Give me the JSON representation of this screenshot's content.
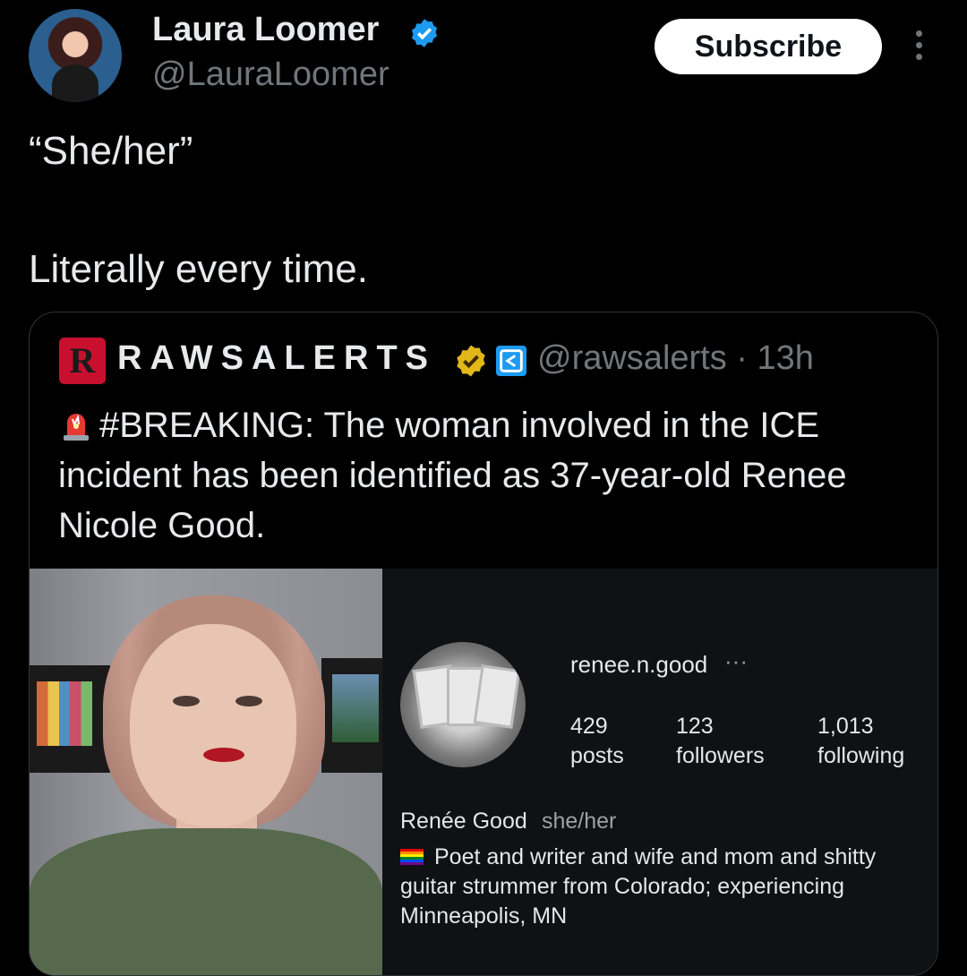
{
  "author": {
    "name": "Laura Loomer",
    "handle": "@LauraLoomer",
    "avatar_icon": "profile-photo",
    "verified_icon": "blue-verified-badge-icon"
  },
  "actions": {
    "subscribe_label": "Subscribe",
    "more_icon": "more-vertical-icon"
  },
  "tweet": {
    "line1": "“She/her”",
    "line2": "Literally every time."
  },
  "quoted": {
    "logo_letter": "R",
    "name": "RAWSALERTS",
    "handle_time": "@rawsalerts · 13h",
    "gold_badge_icon": "gold-verified-badge-icon",
    "affiliate_icon": "affiliate-badge-icon",
    "siren_icon": "police-light-emoji",
    "text": "#BREAKING: The woman involved in the ICE incident has been identified as 37-year-old Renee Nicole Good."
  },
  "instagram_profile": {
    "username": "renee.n.good",
    "menu": "···",
    "stats": [
      {
        "value": "429",
        "label": "posts"
      },
      {
        "value": "123",
        "label": "followers"
      },
      {
        "value": "1,013",
        "label": "following"
      }
    ],
    "display_name": "Renée Good",
    "pronouns": "she/her",
    "flag_icon": "rainbow-flag-emoji",
    "bio_line1": "Poet and writer and wife and mom and shitty",
    "bio_line2": "guitar strummer from Colorado; experiencing",
    "bio_line3": "Minneapolis, MN"
  },
  "colors": {
    "background": "#000000",
    "text": "#e7e9ea",
    "secondary": "#71767b",
    "verified_blue": "#1d9bf0",
    "verified_gold": "#e2b719"
  }
}
